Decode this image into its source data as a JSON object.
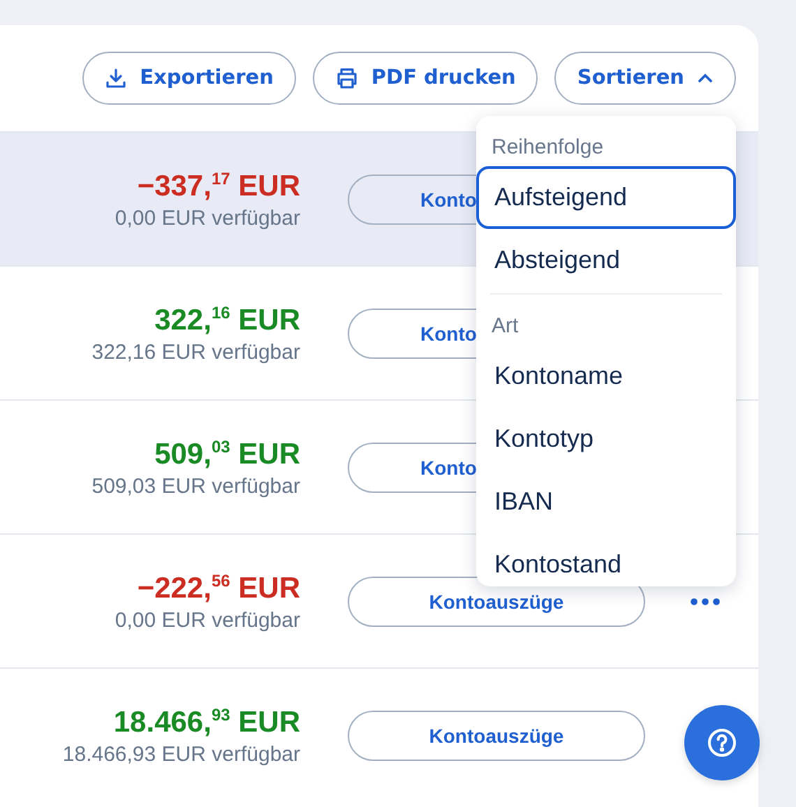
{
  "toolbar": [
    {
      "kind": "export",
      "label": "Exportieren"
    },
    {
      "kind": "print",
      "label": "PDF drucken"
    },
    {
      "kind": "sort",
      "label": "Sortieren",
      "expanded": true
    }
  ],
  "accounts": [
    {
      "amount": "−337,$^{17}$ EUR",
      "negative": true,
      "available": "0,00 EUR verfügbar",
      "statement": "Konto",
      "statement_cut_off": true,
      "highlighted": true
    },
    {
      "amount": "322,$^{16}$ EUR",
      "negative": false,
      "available": "322,16 EUR verfügbar",
      "statement": "Konto",
      "statement_cut_off": true,
      "highlighted": false
    },
    {
      "amount": "509,$^{03}$ EUR",
      "negative": false,
      "available": "509,03 EUR verfügbar",
      "statement": "Konto",
      "statement_cut_off": true,
      "highlighted": false
    },
    {
      "amount": "−222,$^{56}$ EUR",
      "negative": true,
      "available": "0,00 EUR verfügbar",
      "statement": "Kontoauszüge",
      "statement_cut_off": false,
      "more_visible": true,
      "highlighted": false
    },
    {
      "amount": "18.466,$^{93}$ EUR",
      "negative": false,
      "available": "18.466,93 EUR verfügbar",
      "statement": "Kontoauszüge",
      "statement_cut_off": false,
      "highlighted": false
    }
  ],
  "sort_menu": [
    {
      "title": "Reihenfolge",
      "options": [
        {
          "label": "Aufsteigend",
          "selected": true
        },
        {
          "label": "Absteigend",
          "selected": false
        }
      ]
    },
    {
      "title": "Art",
      "options": [
        {
          "label": "Kontoname",
          "selected": false
        },
        {
          "label": "Kontotyp",
          "selected": false
        },
        {
          "label": "IBAN",
          "selected": false
        },
        {
          "label": "Kontostand",
          "selected": false
        }
      ]
    }
  ]
}
